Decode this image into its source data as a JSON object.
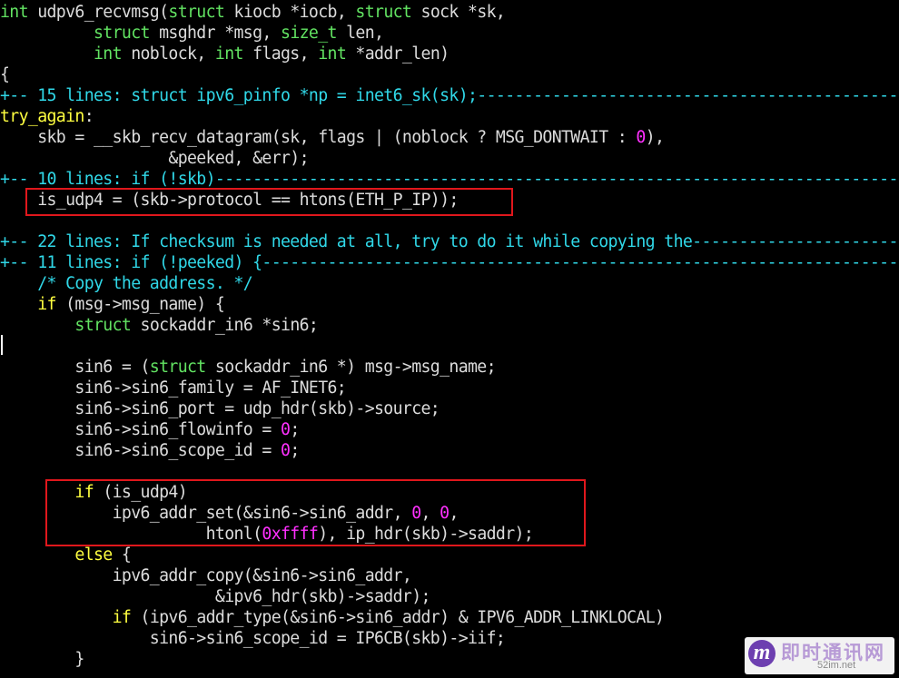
{
  "editor": {
    "lines": [
      [
        {
          "c": "ty",
          "t": "int"
        },
        {
          "c": "",
          "t": " udpv6_recvmsg("
        },
        {
          "c": "ty",
          "t": "struct"
        },
        {
          "c": "",
          "t": " kiocb *iocb, "
        },
        {
          "c": "ty",
          "t": "struct"
        },
        {
          "c": "",
          "t": " sock *sk,"
        }
      ],
      [
        {
          "c": "",
          "t": "          "
        },
        {
          "c": "ty",
          "t": "struct"
        },
        {
          "c": "",
          "t": " msghdr *msg, "
        },
        {
          "c": "ty",
          "t": "size_t"
        },
        {
          "c": "",
          "t": " len,"
        }
      ],
      [
        {
          "c": "",
          "t": "          "
        },
        {
          "c": "ty",
          "t": "int"
        },
        {
          "c": "",
          "t": " noblock, "
        },
        {
          "c": "ty",
          "t": "int"
        },
        {
          "c": "",
          "t": " flags, "
        },
        {
          "c": "ty",
          "t": "int"
        },
        {
          "c": "",
          "t": " *addr_len)"
        }
      ],
      [
        {
          "c": "",
          "t": "{"
        }
      ],
      [
        {
          "c": "fold",
          "t": "+-- 15 lines: struct ipv6_pinfo *np = inet6_sk(sk);------------------------------------------------"
        }
      ],
      [
        {
          "c": "kw",
          "t": "try_again"
        },
        {
          "c": "",
          "t": ":"
        }
      ],
      [
        {
          "c": "",
          "t": "    skb = __skb_recv_datagram(sk, flags | (noblock ? MSG_DONTWAIT : "
        },
        {
          "c": "num",
          "t": "0"
        },
        {
          "c": "",
          "t": "),"
        }
      ],
      [
        {
          "c": "",
          "t": "                  &peeked, &err);"
        }
      ],
      [
        {
          "c": "fold",
          "t": "+-- 10 lines: if (!skb)----------------------------------------------------------------------------"
        }
      ],
      [
        {
          "c": "",
          "t": "    is_udp4 = (skb->protocol == htons(ETH_P_IP));"
        }
      ],
      [
        {
          "c": "",
          "t": ""
        }
      ],
      [
        {
          "c": "fold",
          "t": "+-- 22 lines: If checksum is needed at all, try to do it while copying the----------------------------"
        }
      ],
      [
        {
          "c": "fold",
          "t": "+-- 11 lines: if (!peeked) {---------------------------------------------------------------------------"
        }
      ],
      [
        {
          "c": "",
          "t": "    "
        },
        {
          "c": "cm",
          "t": "/* Copy the address. */"
        }
      ],
      [
        {
          "c": "",
          "t": "    "
        },
        {
          "c": "kw",
          "t": "if"
        },
        {
          "c": "",
          "t": " (msg->msg_name) {"
        }
      ],
      [
        {
          "c": "",
          "t": "        "
        },
        {
          "c": "ty",
          "t": "struct"
        },
        {
          "c": "",
          "t": " sockaddr_in6 *sin6;"
        }
      ],
      [
        {
          "c": "",
          "t": ""
        }
      ],
      [
        {
          "c": "",
          "t": "        sin6 = ("
        },
        {
          "c": "ty",
          "t": "struct"
        },
        {
          "c": "",
          "t": " sockaddr_in6 *) msg->msg_name;"
        }
      ],
      [
        {
          "c": "",
          "t": "        sin6->sin6_family = AF_INET6;"
        }
      ],
      [
        {
          "c": "",
          "t": "        sin6->sin6_port = udp_hdr(skb)->source;"
        }
      ],
      [
        {
          "c": "",
          "t": "        sin6->sin6_flowinfo = "
        },
        {
          "c": "num",
          "t": "0"
        },
        {
          "c": "",
          "t": ";"
        }
      ],
      [
        {
          "c": "",
          "t": "        sin6->sin6_scope_id = "
        },
        {
          "c": "num",
          "t": "0"
        },
        {
          "c": "",
          "t": ";"
        }
      ],
      [
        {
          "c": "",
          "t": ""
        }
      ],
      [
        {
          "c": "",
          "t": "        "
        },
        {
          "c": "kw",
          "t": "if"
        },
        {
          "c": "",
          "t": " (is_udp4)"
        }
      ],
      [
        {
          "c": "",
          "t": "            ipv6_addr_set(&sin6->sin6_addr, "
        },
        {
          "c": "num",
          "t": "0"
        },
        {
          "c": "",
          "t": ", "
        },
        {
          "c": "num",
          "t": "0"
        },
        {
          "c": "",
          "t": ","
        }
      ],
      [
        {
          "c": "",
          "t": "                      htonl("
        },
        {
          "c": "num",
          "t": "0xffff"
        },
        {
          "c": "",
          "t": "), ip_hdr(skb)->saddr);"
        }
      ],
      [
        {
          "c": "",
          "t": "        "
        },
        {
          "c": "kw",
          "t": "else"
        },
        {
          "c": "",
          "t": " {"
        }
      ],
      [
        {
          "c": "",
          "t": "            ipv6_addr_copy(&sin6->sin6_addr,"
        }
      ],
      [
        {
          "c": "",
          "t": "                       &ipv6_hdr(skb)->saddr);"
        }
      ],
      [
        {
          "c": "",
          "t": "            "
        },
        {
          "c": "kw",
          "t": "if"
        },
        {
          "c": "",
          "t": " (ipv6_addr_type(&sin6->sin6_addr) & IPV6_ADDR_LINKLOCAL)"
        }
      ],
      [
        {
          "c": "",
          "t": "                sin6->sin6_scope_id = IP6CB(skb)->iif;"
        }
      ],
      [
        {
          "c": "",
          "t": "        }"
        }
      ]
    ]
  },
  "annotation_color": "#e0171c",
  "watermark": {
    "logo_letter": "m",
    "title": "即时通讯网",
    "url": "52im.net"
  }
}
